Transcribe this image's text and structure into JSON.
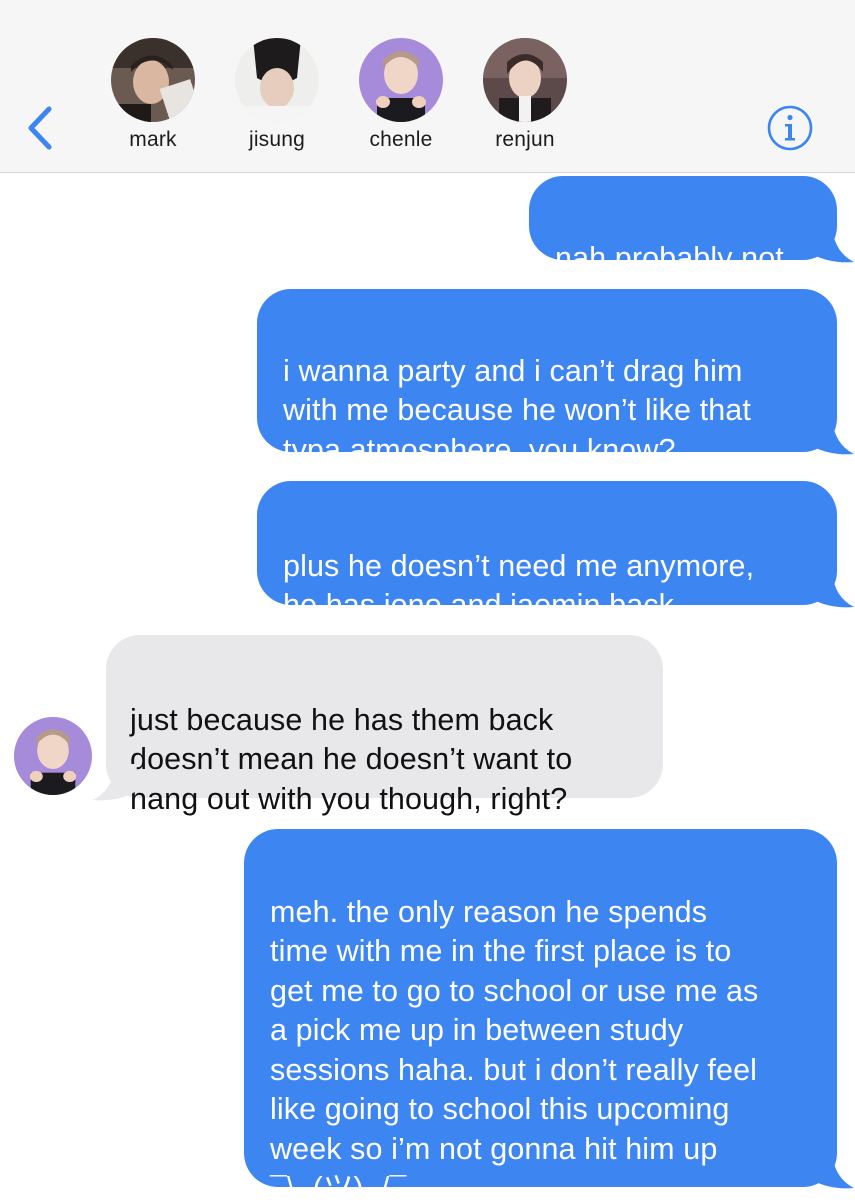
{
  "header": {
    "participants": [
      {
        "name": "mark"
      },
      {
        "name": "jisung"
      },
      {
        "name": "chenle"
      },
      {
        "name": "renjun"
      }
    ],
    "back_icon": "chevron-left-icon",
    "info_icon": "info-circle-icon"
  },
  "messages": [
    {
      "direction": "sent",
      "text": "nah probably not"
    },
    {
      "direction": "sent",
      "text": "i wanna party and i can’t drag him\nwith me because he won’t like that\ntypa atmosphere, you know?"
    },
    {
      "direction": "sent",
      "text": "plus he doesn’t need me anymore,\nhe has jeno and jaemin back"
    },
    {
      "direction": "received",
      "sender": "chenle",
      "text": "just because he has them back\ndoesn’t mean he doesn’t want to\nhang out with you though, right?"
    },
    {
      "direction": "sent",
      "text": "meh. the only reason he spends\ntime with me in the first place is to\nget me to go to school or use me as\na pick me up in between study\nsessions haha. but i don’t really feel\nlike going to school this upcoming\nweek so i’m not gonna hit him up\n¯\\_(ツ)_/¯"
    }
  ],
  "colors": {
    "sent_bubble": "#3d86f1",
    "received_bubble": "#e8e8ea",
    "accent": "#3d86f1",
    "header_bg": "#f6f6f7"
  }
}
